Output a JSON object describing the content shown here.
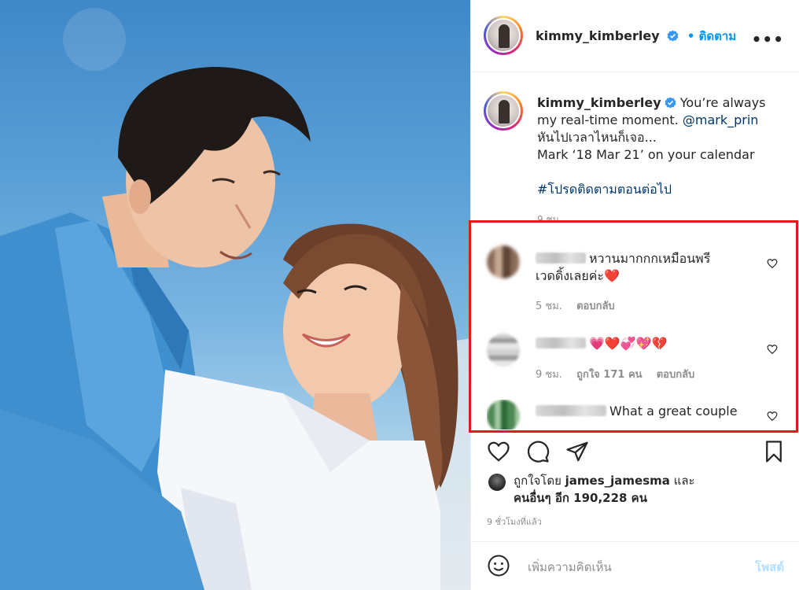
{
  "post": {
    "username": "kimmy_kimberley",
    "follow_label": "• ติดตาม",
    "more_label": "•••",
    "verified_icon": "verified-badge-icon"
  },
  "caption": {
    "username": "kimmy_kimberley",
    "line1": "You’re always my real-time moment.",
    "mention": "@mark_prin",
    "line2": "หันไปเวลาไหนก็เจอ...",
    "line3": "Mark ‘18 Mar 21’ on your calendar",
    "hashtag": "#โปรดติดตามตอนต่อไป",
    "time": "9 ชม."
  },
  "comments": [
    {
      "text": "หวานมากกกเหมือนพรีเวดดิ้งเลยค่ะ❤️",
      "time": "5 ชม.",
      "reply": "ตอบกลับ",
      "likes": ""
    },
    {
      "text": "💗❤️💞💖💔",
      "time": "9 ชม.",
      "likes": "ถูกใจ 171 คน",
      "reply": "ตอบกลับ"
    },
    {
      "text": "What a great couple",
      "time": "",
      "likes": "",
      "reply": ""
    }
  ],
  "likes": {
    "prefix": "ถูกใจโดย",
    "user": "james_jamesma",
    "and": "และ",
    "others": "คนอื่นๆ อีก 190,228 คน"
  },
  "posted_time": "9 ชั่วโมงที่แล้ว",
  "comment_input": {
    "placeholder": "เพิ่มความคิดเห็น",
    "post_label": "โพสต์"
  },
  "colors": {
    "accent": "#0095f6",
    "highlight_box": "#e01b1b",
    "muted": "#8e8e8e"
  }
}
